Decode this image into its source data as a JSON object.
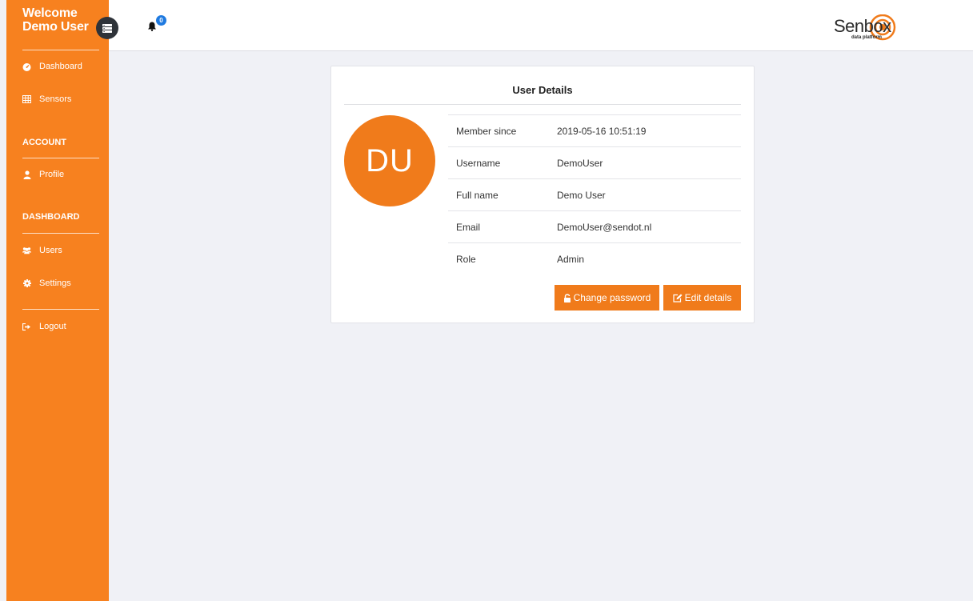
{
  "sidebar": {
    "welcome_line1": "Welcome",
    "welcome_line2": "Demo User",
    "items": [
      {
        "label": "Dashboard",
        "icon": "dashboard-icon"
      },
      {
        "label": "Sensors",
        "icon": "table-icon"
      }
    ],
    "account_heading": "ACCOUNT",
    "account_items": [
      {
        "label": "Profile",
        "icon": "user-icon"
      }
    ],
    "dashboard_heading": "DASHBOARD",
    "dashboard_items": [
      {
        "label": "Users",
        "icon": "users-icon"
      },
      {
        "label": "Settings",
        "icon": "gear-icon"
      }
    ],
    "logout_label": "Logout"
  },
  "topbar": {
    "notification_count": "0",
    "logo_text": "Senbox",
    "logo_subtitle": "data platform"
  },
  "card": {
    "title": "User Details",
    "avatar_initials": "DU",
    "details": [
      {
        "label": "Member since",
        "value": "2019-05-16 10:51:19"
      },
      {
        "label": "Username",
        "value": "DemoUser"
      },
      {
        "label": "Full name",
        "value": "Demo User"
      },
      {
        "label": "Email",
        "value": "DemoUser@sendot.nl"
      },
      {
        "label": "Role",
        "value": "Admin"
      }
    ],
    "change_password_label": "Change password",
    "edit_details_label": "Edit details"
  },
  "colors": {
    "accent": "#f7811f",
    "button": "#f07b1b",
    "background": "#f0f1f6",
    "badge": "#1f7ae0"
  }
}
